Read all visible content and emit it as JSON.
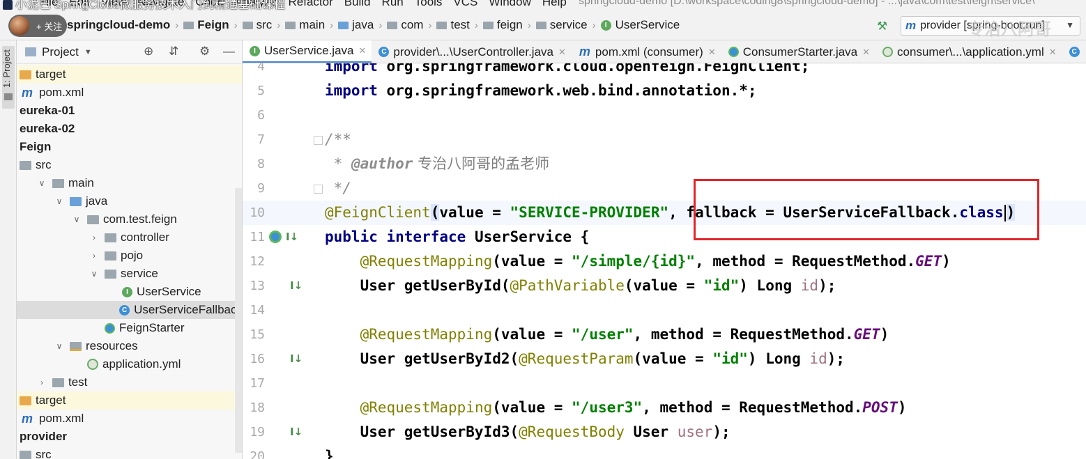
{
  "menubar": {
    "overlay_text": "小泥巴 SpringCloud微服务技术入门到精通基础课程",
    "items": [
      "File",
      "Edit",
      "View",
      "Navigate",
      "Code",
      "Analyze",
      "Refactor",
      "Build",
      "Run",
      "Tools",
      "VCS",
      "Window",
      "Help"
    ],
    "window_title": "springcloud-demo [D:\\workspace\\coding8\\springcloud-demo] - ...\\java\\com\\test\\feign\\service\\"
  },
  "navbar": {
    "follow_label": "+ 关注",
    "breadcrumbs": [
      "springcloud-demo",
      "Feign",
      "src",
      "main",
      "java",
      "com",
      "test",
      "feign",
      "service",
      "UserService"
    ],
    "run_config": "provider [spring-boot:run]",
    "watermark": "专治八阿哥"
  },
  "toolstrip": {
    "project_tab": "1: Project"
  },
  "project_panel": {
    "title": "Project",
    "tree": [
      {
        "label": "target",
        "icon": "folder-orange-icon",
        "indent": 0,
        "arrow": "",
        "bold": false,
        "hl": "yellow"
      },
      {
        "label": "pom.xml",
        "icon": "maven-icon",
        "indent": 0,
        "arrow": "",
        "bold": false,
        "hl": ""
      },
      {
        "label": "eureka-01",
        "icon": "",
        "indent": 0,
        "arrow": "",
        "bold": true,
        "hl": ""
      },
      {
        "label": "eureka-02",
        "icon": "",
        "indent": 0,
        "arrow": "",
        "bold": true,
        "hl": ""
      },
      {
        "label": "Feign",
        "icon": "",
        "indent": 0,
        "arrow": "",
        "bold": true,
        "hl": ""
      },
      {
        "label": "src",
        "icon": "folder-grey-icon",
        "indent": 0,
        "arrow": "",
        "bold": false,
        "hl": ""
      },
      {
        "label": "main",
        "icon": "folder-grey-icon",
        "indent": 1,
        "arrow": "down",
        "bold": false,
        "hl": ""
      },
      {
        "label": "java",
        "icon": "folder-blue-icon",
        "indent": 2,
        "arrow": "down",
        "bold": false,
        "hl": ""
      },
      {
        "label": "com.test.feign",
        "icon": "package-icon",
        "indent": 3,
        "arrow": "down",
        "bold": false,
        "hl": ""
      },
      {
        "label": "controller",
        "icon": "package-icon",
        "indent": 4,
        "arrow": "right",
        "bold": false,
        "hl": ""
      },
      {
        "label": "pojo",
        "icon": "package-icon",
        "indent": 4,
        "arrow": "right",
        "bold": false,
        "hl": ""
      },
      {
        "label": "service",
        "icon": "package-icon",
        "indent": 4,
        "arrow": "down",
        "bold": false,
        "hl": ""
      },
      {
        "label": "UserService",
        "icon": "interface-icon",
        "indent": 5,
        "arrow": "",
        "bold": false,
        "hl": ""
      },
      {
        "label": "UserServiceFallback",
        "icon": "class-icon",
        "indent": 5,
        "arrow": "",
        "bold": false,
        "hl": "grey"
      },
      {
        "label": "FeignStarter",
        "icon": "spring-boot-class-icon",
        "indent": 4,
        "arrow": "",
        "bold": false,
        "hl": ""
      },
      {
        "label": "resources",
        "icon": "resources-folder-icon",
        "indent": 2,
        "arrow": "down",
        "bold": false,
        "hl": ""
      },
      {
        "label": "application.yml",
        "icon": "yml-icon",
        "indent": 3,
        "arrow": "",
        "bold": false,
        "hl": ""
      },
      {
        "label": "test",
        "icon": "folder-grey-icon",
        "indent": 1,
        "arrow": "right",
        "bold": false,
        "hl": ""
      },
      {
        "label": "target",
        "icon": "folder-orange-icon",
        "indent": 0,
        "arrow": "",
        "bold": false,
        "hl": "yellow"
      },
      {
        "label": "pom.xml",
        "icon": "maven-icon",
        "indent": 0,
        "arrow": "",
        "bold": false,
        "hl": ""
      },
      {
        "label": "provider",
        "icon": "",
        "indent": 0,
        "arrow": "",
        "bold": true,
        "hl": ""
      },
      {
        "label": "src",
        "icon": "folder-grey-icon",
        "indent": 0,
        "arrow": "",
        "bold": false,
        "hl": ""
      }
    ]
  },
  "tabs": [
    {
      "label": "UserService.java",
      "icon": "interface-icon",
      "active": true
    },
    {
      "label": "provider\\...\\UserController.java",
      "icon": "class-icon",
      "active": false
    },
    {
      "label": "pom.xml (consumer)",
      "icon": "maven-icon",
      "active": false
    },
    {
      "label": "ConsumerStarter.java",
      "icon": "spring-boot-class-icon",
      "active": false
    },
    {
      "label": "consumer\\...\\application.yml",
      "icon": "yml-icon",
      "active": false
    },
    {
      "label": "",
      "icon": "class-icon",
      "active": false
    }
  ],
  "editor": {
    "lines": [
      {
        "num": "4",
        "tokens": [
          [
            "k",
            "import "
          ],
          [
            "plain",
            "org.springframework.cloud.openfeign.FeignClient;"
          ]
        ]
      },
      {
        "num": "5",
        "tokens": [
          [
            "k",
            "import "
          ],
          [
            "plain",
            "org.springframework.web.bind.annotation.*;"
          ]
        ]
      },
      {
        "num": "6",
        "tokens": []
      },
      {
        "num": "7",
        "tokens": [
          [
            "cmt",
            "/**"
          ]
        ]
      },
      {
        "num": "8",
        "tokens": [
          [
            "cmt",
            " * "
          ],
          [
            "tag",
            "@author"
          ],
          [
            "cn",
            " 专治八阿哥的孟老师"
          ]
        ]
      },
      {
        "num": "9",
        "tokens": [
          [
            "cmt",
            " */"
          ]
        ]
      },
      {
        "num": "10",
        "tokens": [
          [
            "ann",
            "@FeignClient"
          ],
          [
            "paren",
            "("
          ],
          [
            "plain",
            "value = "
          ],
          [
            "str",
            "\"SERVICE-PROVIDER\""
          ],
          [
            "plain",
            ", fallback = UserServiceFallback."
          ],
          [
            "k",
            "class"
          ],
          [
            "caret",
            ""
          ],
          [
            "paren",
            ")"
          ]
        ]
      },
      {
        "num": "11",
        "tokens": [
          [
            "k",
            "public interface "
          ],
          [
            "plain",
            "UserService {"
          ]
        ]
      },
      {
        "num": "12",
        "tokens": [
          [
            "plain",
            "    "
          ],
          [
            "ann",
            "@RequestMapping"
          ],
          [
            "plain",
            "(value = "
          ],
          [
            "str",
            "\"/simple/{id}\""
          ],
          [
            "plain",
            ", method = RequestMethod."
          ],
          [
            "fld",
            "GET"
          ],
          [
            "plain",
            ")"
          ]
        ]
      },
      {
        "num": "13",
        "tokens": [
          [
            "plain",
            "    User getUserById("
          ],
          [
            "ann",
            "@PathVariable"
          ],
          [
            "plain",
            "(value = "
          ],
          [
            "str",
            "\"id\""
          ],
          [
            "plain",
            ") Long "
          ],
          [
            "param",
            "id"
          ],
          [
            "plain",
            ");"
          ]
        ]
      },
      {
        "num": "14",
        "tokens": []
      },
      {
        "num": "15",
        "tokens": [
          [
            "plain",
            "    "
          ],
          [
            "ann",
            "@RequestMapping"
          ],
          [
            "plain",
            "(value = "
          ],
          [
            "str",
            "\"/user\""
          ],
          [
            "plain",
            ", method = RequestMethod."
          ],
          [
            "fld",
            "GET"
          ],
          [
            "plain",
            ")"
          ]
        ]
      },
      {
        "num": "16",
        "tokens": [
          [
            "plain",
            "    User getUserById2("
          ],
          [
            "ann",
            "@RequestParam"
          ],
          [
            "plain",
            "(value = "
          ],
          [
            "str",
            "\"id\""
          ],
          [
            "plain",
            ") Long "
          ],
          [
            "param",
            "id"
          ],
          [
            "plain",
            ");"
          ]
        ]
      },
      {
        "num": "17",
        "tokens": []
      },
      {
        "num": "18",
        "tokens": [
          [
            "plain",
            "    "
          ],
          [
            "ann",
            "@RequestMapping"
          ],
          [
            "plain",
            "(value = "
          ],
          [
            "str",
            "\"/user3\""
          ],
          [
            "plain",
            ", method = RequestMethod."
          ],
          [
            "fld",
            "POST"
          ],
          [
            "plain",
            ")"
          ]
        ]
      },
      {
        "num": "19",
        "tokens": [
          [
            "plain",
            "    User getUserById3("
          ],
          [
            "ann",
            "@RequestBody"
          ],
          [
            "plain",
            " User "
          ],
          [
            "param",
            "user"
          ],
          [
            "plain",
            ");"
          ]
        ]
      },
      {
        "num": "20",
        "tokens": [
          [
            "plain",
            "}"
          ]
        ]
      }
    ],
    "gutter_marks": {
      "11": [
        "run-icon",
        "implemented-icon"
      ],
      "13": [
        "implemented-icon"
      ],
      "16": [
        "implemented-icon"
      ],
      "19": [
        "implemented-icon"
      ]
    },
    "fold_lines": [
      "7",
      "9"
    ],
    "current_line": "10"
  }
}
